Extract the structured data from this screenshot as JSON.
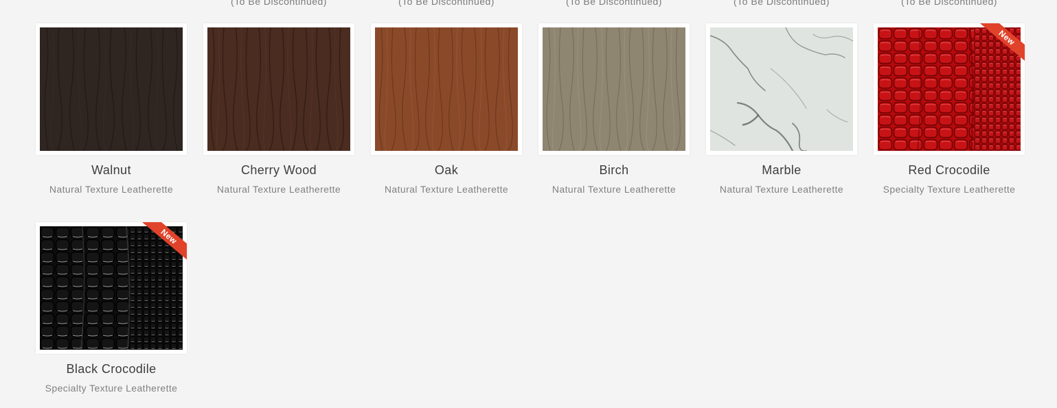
{
  "top_notes": [
    "",
    "(To Be Discontinued)",
    "(To Be Discontinued)",
    "(To Be Discontinued)",
    "(To Be Discontinued)",
    "(To Be Discontinued)"
  ],
  "swatches": [
    {
      "name": "Walnut",
      "subtitle": "Natural Texture Leatherette",
      "badge": ""
    },
    {
      "name": "Cherry Wood",
      "subtitle": "Natural Texture Leatherette",
      "badge": ""
    },
    {
      "name": "Oak",
      "subtitle": "Natural Texture Leatherette",
      "badge": ""
    },
    {
      "name": "Birch",
      "subtitle": "Natural Texture Leatherette",
      "badge": ""
    },
    {
      "name": "Marble",
      "subtitle": "Natural Texture Leatherette",
      "badge": ""
    },
    {
      "name": "Red Crocodile",
      "subtitle": "Specialty Texture Leatherette",
      "badge": "New"
    },
    {
      "name": "Black Crocodile",
      "subtitle": "Specialty Texture Leatherette",
      "badge": "New"
    }
  ],
  "colors": {
    "walnut": "#2f2521",
    "cherry_wood": "#4a2c20",
    "oak": "#8a4a2a",
    "birch": "#8f8672",
    "marble": "#dfe4e0",
    "red_crocodile": "#b5090b",
    "black_crocodile": "#0d0d0d",
    "badge": "#e0432a"
  }
}
